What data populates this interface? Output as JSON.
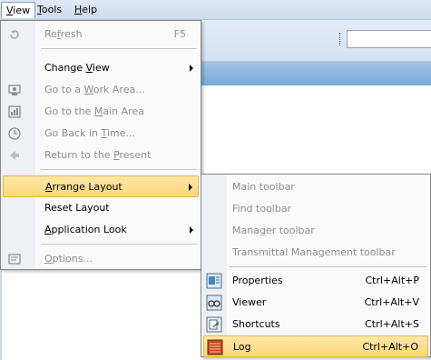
{
  "menubar": {
    "items": [
      {
        "label": "View",
        "mnemonic_index": 0
      },
      {
        "label": "Tools",
        "mnemonic_index": 0
      },
      {
        "label": "Help",
        "mnemonic_index": 0
      }
    ]
  },
  "view_menu": {
    "items": [
      {
        "pre": "Re",
        "mn": "f",
        "post": "resh",
        "shortcut": "F5",
        "disabled": true,
        "icon": "refresh-icon"
      },
      {
        "pre": "Change ",
        "mn": "V",
        "post": "iew",
        "submenu": true,
        "icon": ""
      },
      {
        "pre": "Go to a ",
        "mn": "W",
        "post": "ork Area...",
        "disabled": true,
        "icon": "work-area-icon"
      },
      {
        "pre": "Go to the ",
        "mn": "M",
        "post": "ain Area",
        "disabled": true,
        "icon": "main-area-icon"
      },
      {
        "pre": "Go Back in ",
        "mn": "T",
        "post": "ime...",
        "disabled": true,
        "icon": "clock-icon"
      },
      {
        "pre": "Return to the ",
        "mn": "P",
        "post": "resent",
        "disabled": true,
        "icon": "return-icon"
      },
      {
        "pre": "",
        "mn": "A",
        "post": "rrange Layout",
        "submenu": true,
        "highlighted": true
      },
      {
        "pre": "Reset Layout",
        "mn": "",
        "post": ""
      },
      {
        "pre": "",
        "mn": "A",
        "post": "pplication Look",
        "submenu": true
      },
      {
        "pre": "",
        "mn": "O",
        "post": "ptions...",
        "disabled": true,
        "icon": "options-icon"
      }
    ]
  },
  "arrange_layout_submenu": {
    "items": [
      {
        "label": "Main toolbar",
        "disabled": true
      },
      {
        "label": "Find toolbar",
        "disabled": true
      },
      {
        "label": "Manager toolbar",
        "disabled": true
      },
      {
        "label": "Transmittal Management toolbar",
        "disabled": true
      },
      {
        "label": "Properties",
        "shortcut": "Ctrl+Alt+P",
        "icon": "properties-icon"
      },
      {
        "label": "Viewer",
        "shortcut": "Ctrl+Alt+V",
        "icon": "viewer-icon"
      },
      {
        "label": "Shortcuts",
        "shortcut": "Ctrl+Alt+S",
        "icon": "shortcuts-icon"
      },
      {
        "label": "Log",
        "shortcut": "Ctrl+Alt+O",
        "icon": "log-icon",
        "highlighted": true
      }
    ]
  },
  "colors": {
    "highlight": "#fbd779",
    "highlight_border": "#e2b74d",
    "disabled_text": "#8d8d8d",
    "band": "#7aaad8"
  }
}
